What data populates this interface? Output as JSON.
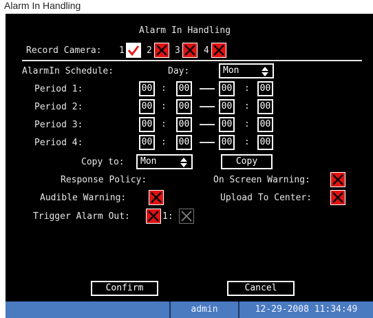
{
  "caption": "Alarm In Handling",
  "title": "Alarm In Handling",
  "record_camera": {
    "label": "Record Camera:",
    "cameras": [
      {
        "num": "1",
        "state": "checked"
      },
      {
        "num": "2",
        "state": "crossed"
      },
      {
        "num": "3",
        "state": "crossed"
      },
      {
        "num": "4",
        "state": "crossed"
      }
    ]
  },
  "schedule": {
    "label": "AlarmIn Schedule:",
    "day_label": "Day:",
    "day_value": "Mon",
    "periods": [
      {
        "label": "Period 1:",
        "start_h": "00",
        "start_m": "00",
        "end_h": "00",
        "end_m": "00"
      },
      {
        "label": "Period 2:",
        "start_h": "00",
        "start_m": "00",
        "end_h": "00",
        "end_m": "00"
      },
      {
        "label": "Period 3:",
        "start_h": "00",
        "start_m": "00",
        "end_h": "00",
        "end_m": "00"
      },
      {
        "label": "Period 4:",
        "start_h": "00",
        "start_m": "00",
        "end_h": "00",
        "end_m": "00"
      }
    ],
    "time_sep": ":",
    "copy_to_label": "Copy to:",
    "copy_to_value": "Mon",
    "copy_button": "Copy"
  },
  "response": {
    "policy_label": "Response Policy:",
    "on_screen_warning": "On Screen Warning:",
    "audible_warning": "Audible Warning:",
    "upload_to_center": "Upload To Center:",
    "trigger_alarm_out": "Trigger Alarm Out:",
    "alarm_out_num": "1:"
  },
  "buttons": {
    "confirm": "Confirm",
    "cancel": "Cancel"
  },
  "status": {
    "user": "admin",
    "datetime": "12-29-2008 11:34:49"
  },
  "colors": {
    "background": "#000000",
    "checkbox_red": "#e21212",
    "check_mark": "#e02020",
    "status_bar": "#4a7ac0",
    "text": "#e8e8e8"
  },
  "icons": {
    "crossed_checkbox": "red-cross-icon",
    "checked_checkbox": "check-mark-icon",
    "select_arrows": "up-down-arrows-icon"
  }
}
